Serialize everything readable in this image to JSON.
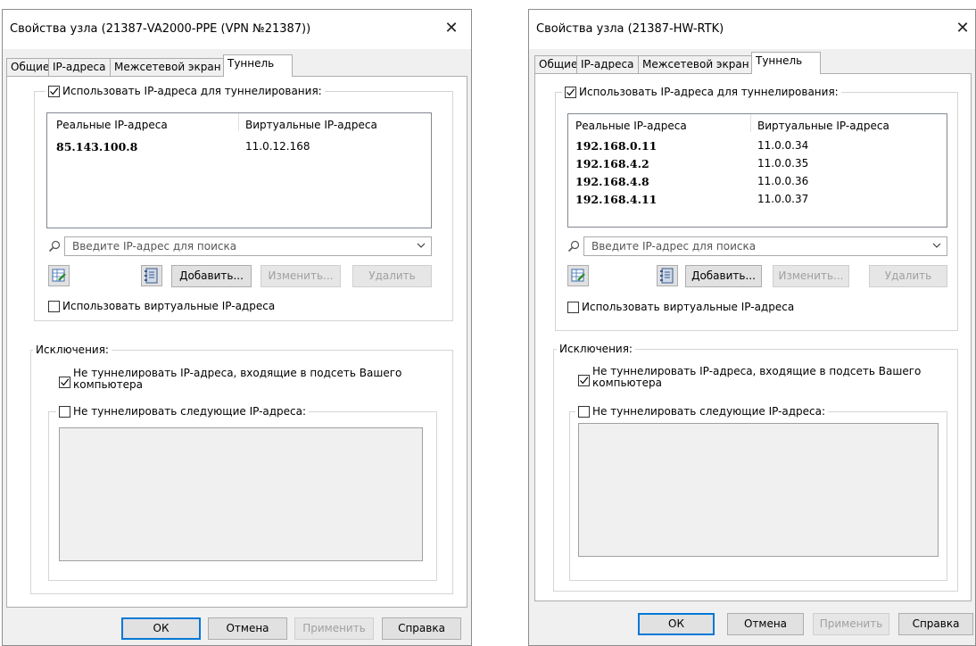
{
  "dialogs": [
    {
      "title": "Свойства узла (21387-VA2000-PPE (VPN №21387))",
      "close_glyph": "✕",
      "tabs": [
        "Общие",
        "IP-адреса",
        "Межсетевой экран",
        "Туннель"
      ],
      "active_tab": "Туннель",
      "use_ip_tunneling": {
        "label": "Использовать IP-адреса для туннелирования:",
        "checked": true
      },
      "columns": [
        "Реальные IP-адреса",
        "Виртуальные IP-адреса"
      ],
      "rows": [
        {
          "real": "85.143.100.8",
          "virtual": "11.0.12.168"
        }
      ],
      "search_placeholder": "Введите IP-адрес для поиска",
      "buttons": {
        "add": "Добавить...",
        "edit": "Изменить...",
        "delete": "Удалить"
      },
      "use_virtual": {
        "label": "Использовать виртуальные IP-адреса",
        "checked": false
      },
      "exceptions": {
        "title": "Исключения:",
        "no_tunnel_subnet": {
          "label_line1": "Не туннелировать IP-адреса, входящие в подсеть Вашего",
          "label_line2": "компьютера",
          "checked": true
        },
        "no_tunnel_following": {
          "label": "Не туннелировать следующие IP-адреса:",
          "checked": false
        }
      },
      "footer": {
        "ok": "ОК",
        "cancel": "Отмена",
        "apply": "Применить",
        "help": "Справка"
      }
    },
    {
      "title": "Свойства узла (21387-HW-RTK)",
      "close_glyph": "✕",
      "tabs": [
        "Общие",
        "IP-адреса",
        "Межсетевой экран",
        "Туннель"
      ],
      "active_tab": "Туннель",
      "use_ip_tunneling": {
        "label": "Использовать IP-адреса для туннелирования:",
        "checked": true
      },
      "columns": [
        "Реальные IP-адреса",
        "Виртуальные IP-адреса"
      ],
      "rows": [
        {
          "real": "192.168.0.11",
          "virtual": "11.0.0.34"
        },
        {
          "real": "192.168.4.2",
          "virtual": "11.0.0.35"
        },
        {
          "real": "192.168.4.8",
          "virtual": "11.0.0.36"
        },
        {
          "real": "192.168.4.11",
          "virtual": "11.0.0.37"
        }
      ],
      "search_placeholder": "Введите IP-адрес для поиска",
      "buttons": {
        "add": "Добавить...",
        "edit": "Изменить...",
        "delete": "Удалить"
      },
      "use_virtual": {
        "label": "Использовать виртуальные IP-адреса",
        "checked": false
      },
      "exceptions": {
        "title": "Исключения:",
        "no_tunnel_subnet": {
          "label_line1": "Не туннелировать IP-адреса, входящие в подсеть Вашего",
          "label_line2": "компьютера",
          "checked": true
        },
        "no_tunnel_following": {
          "label": "Не туннелировать следующие IP-адреса:",
          "checked": false
        }
      },
      "footer": {
        "ok": "ОК",
        "cancel": "Отмена",
        "apply": "Применить",
        "help": "Справка"
      }
    }
  ],
  "colors": {
    "dialog_bg": "#f0f0f0",
    "accent": "#0078d7",
    "disabled_text": "#a0a0a0"
  },
  "icons": [
    "search-icon",
    "chevron-down-icon",
    "table-edit-icon",
    "address-book-icon",
    "check-icon",
    "close-icon"
  ]
}
